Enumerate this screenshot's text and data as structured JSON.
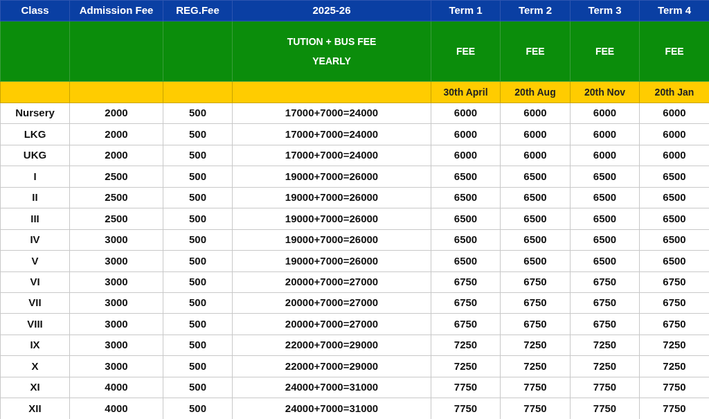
{
  "table": {
    "columns": [
      "Class",
      "Admission Fee",
      "REG.Fee",
      "2025-26",
      "Term 1",
      "Term 2",
      "Term 3",
      "Term 4"
    ],
    "yearly_heading": [
      "TUTION + BUS FEE",
      "YEARLY"
    ],
    "term_headings": [
      "FEE",
      "FEE",
      "FEE",
      "FEE"
    ],
    "due_dates": [
      "30th April",
      "20th Aug",
      "20th Nov",
      "20th Jan"
    ],
    "rows": [
      {
        "class": "Nursery",
        "admission_fee": "2000",
        "reg_fee": "500",
        "yearly": "17000+7000=24000",
        "terms": [
          "6000",
          "6000",
          "6000",
          "6000"
        ]
      },
      {
        "class": "LKG",
        "admission_fee": "2000",
        "reg_fee": "500",
        "yearly": "17000+7000=24000",
        "terms": [
          "6000",
          "6000",
          "6000",
          "6000"
        ]
      },
      {
        "class": "UKG",
        "admission_fee": "2000",
        "reg_fee": "500",
        "yearly": "17000+7000=24000",
        "terms": [
          "6000",
          "6000",
          "6000",
          "6000"
        ]
      },
      {
        "class": "I",
        "admission_fee": "2500",
        "reg_fee": "500",
        "yearly": "19000+7000=26000",
        "terms": [
          "6500",
          "6500",
          "6500",
          "6500"
        ]
      },
      {
        "class": "II",
        "admission_fee": "2500",
        "reg_fee": "500",
        "yearly": "19000+7000=26000",
        "terms": [
          "6500",
          "6500",
          "6500",
          "6500"
        ]
      },
      {
        "class": "III",
        "admission_fee": "2500",
        "reg_fee": "500",
        "yearly": "19000+7000=26000",
        "terms": [
          "6500",
          "6500",
          "6500",
          "6500"
        ]
      },
      {
        "class": "IV",
        "admission_fee": "3000",
        "reg_fee": "500",
        "yearly": "19000+7000=26000",
        "terms": [
          "6500",
          "6500",
          "6500",
          "6500"
        ]
      },
      {
        "class": "V",
        "admission_fee": "3000",
        "reg_fee": "500",
        "yearly": "19000+7000=26000",
        "terms": [
          "6500",
          "6500",
          "6500",
          "6500"
        ]
      },
      {
        "class": "VI",
        "admission_fee": "3000",
        "reg_fee": "500",
        "yearly": "20000+7000=27000",
        "terms": [
          "6750",
          "6750",
          "6750",
          "6750"
        ]
      },
      {
        "class": "VII",
        "admission_fee": "3000",
        "reg_fee": "500",
        "yearly": "20000+7000=27000",
        "terms": [
          "6750",
          "6750",
          "6750",
          "6750"
        ]
      },
      {
        "class": "VIII",
        "admission_fee": "3000",
        "reg_fee": "500",
        "yearly": "20000+7000=27000",
        "terms": [
          "6750",
          "6750",
          "6750",
          "6750"
        ]
      },
      {
        "class": "IX",
        "admission_fee": "3000",
        "reg_fee": "500",
        "yearly": "22000+7000=29000",
        "terms": [
          "7250",
          "7250",
          "7250",
          "7250"
        ]
      },
      {
        "class": "X",
        "admission_fee": "3000",
        "reg_fee": "500",
        "yearly": "22000+7000=29000",
        "terms": [
          "7250",
          "7250",
          "7250",
          "7250"
        ]
      },
      {
        "class": "XI",
        "admission_fee": "4000",
        "reg_fee": "500",
        "yearly": "24000+7000=31000",
        "terms": [
          "7750",
          "7750",
          "7750",
          "7750"
        ]
      },
      {
        "class": "XII",
        "admission_fee": "4000",
        "reg_fee": "500",
        "yearly": "24000+7000=31000",
        "terms": [
          "7750",
          "7750",
          "7750",
          "7750"
        ]
      }
    ]
  }
}
